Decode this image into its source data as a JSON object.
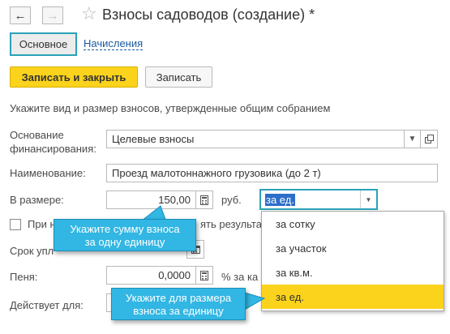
{
  "nav": {
    "back_icon": "arrow-left-icon",
    "forward_icon": "arrow-right-icon",
    "favorite_icon": "star-icon"
  },
  "header": {
    "title": "Взносы садоводов (создание) *"
  },
  "tabs": [
    {
      "label": "Основное",
      "active": true
    },
    {
      "label": "Начисления",
      "active": false
    }
  ],
  "toolbar": {
    "save_close_label": "Записать и закрыть",
    "save_label": "Записать"
  },
  "form": {
    "hint": "Укажите вид и размер взносов, утвержденные общим собранием",
    "funding_label_line1": "Основание",
    "funding_label_line2": "финансирования:",
    "funding_value": "Целевые взносы",
    "name_label": "Наименование:",
    "name_value": "Проезд малотоннажного грузовика (до 2 т)",
    "amount_label": "В размере:",
    "amount_value": "150,00",
    "currency": "руб.",
    "unit_value": "за ед.",
    "checkbox_label_start": "При н",
    "checkbox_label_end": "ять результат",
    "term_label": "Срок упл",
    "penalty_label": "Пеня:",
    "penalty_value": "0,0000",
    "penalty_unit": "% за ка",
    "valid_label": "Действует для:"
  },
  "dropdown": {
    "options": [
      "за сотку",
      "за участок",
      "за кв.м.",
      "за ед."
    ],
    "selected": "за ед."
  },
  "callouts": {
    "amount_line1": "Укажите сумму взноса",
    "amount_line2": "за одну единицу",
    "unit_line1": "Укажите для размера",
    "unit_line2": "взноса за единицу"
  },
  "colors": {
    "accent_yellow": "#fbd31c",
    "focus_teal": "#2aa2b8",
    "callout_blue": "#32b6e3",
    "link_blue": "#1a5aa0"
  }
}
